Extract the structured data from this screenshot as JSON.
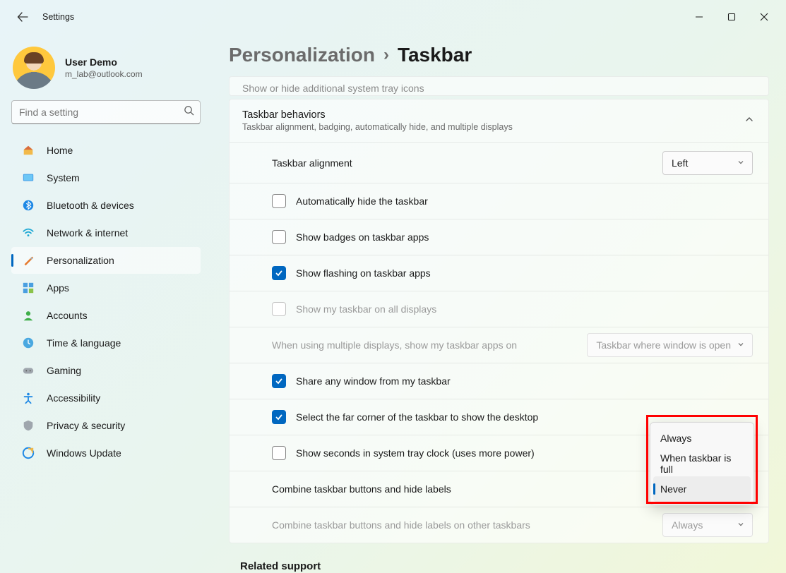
{
  "window": {
    "title": "Settings"
  },
  "user": {
    "name": "User Demo",
    "email": "m_lab@outlook.com"
  },
  "search": {
    "placeholder": "Find a setting"
  },
  "nav": [
    {
      "label": "Home"
    },
    {
      "label": "System"
    },
    {
      "label": "Bluetooth & devices"
    },
    {
      "label": "Network & internet"
    },
    {
      "label": "Personalization"
    },
    {
      "label": "Apps"
    },
    {
      "label": "Accounts"
    },
    {
      "label": "Time & language"
    },
    {
      "label": "Gaming"
    },
    {
      "label": "Accessibility"
    },
    {
      "label": "Privacy & security"
    },
    {
      "label": "Windows Update"
    }
  ],
  "breadcrumb": {
    "parent": "Personalization",
    "current": "Taskbar"
  },
  "stub_header": "Show or hide additional system tray icons",
  "behaviors": {
    "title": "Taskbar behaviors",
    "subtitle": "Taskbar alignment, badging, automatically hide, and multiple displays",
    "alignment": {
      "label": "Taskbar alignment",
      "value": "Left"
    },
    "rows": {
      "auto_hide": "Automatically hide the taskbar",
      "badges": "Show badges on taskbar apps",
      "flashing": "Show flashing on taskbar apps",
      "all_displays": "Show my taskbar on all displays",
      "multi_display": {
        "label": "When using multiple displays, show my taskbar apps on",
        "value": "Taskbar where window is open"
      },
      "share": "Share any window from my taskbar",
      "far_corner": "Select the far corner of the taskbar to show the desktop",
      "seconds": "Show seconds in system tray clock (uses more power)",
      "combine": "Combine taskbar buttons and hide labels",
      "combine_other": {
        "label": "Combine taskbar buttons and hide labels on other taskbars",
        "value": "Always"
      }
    }
  },
  "popup": {
    "opt0": "Always",
    "opt1": "When taskbar is full",
    "opt2": "Never"
  },
  "related": "Related support"
}
